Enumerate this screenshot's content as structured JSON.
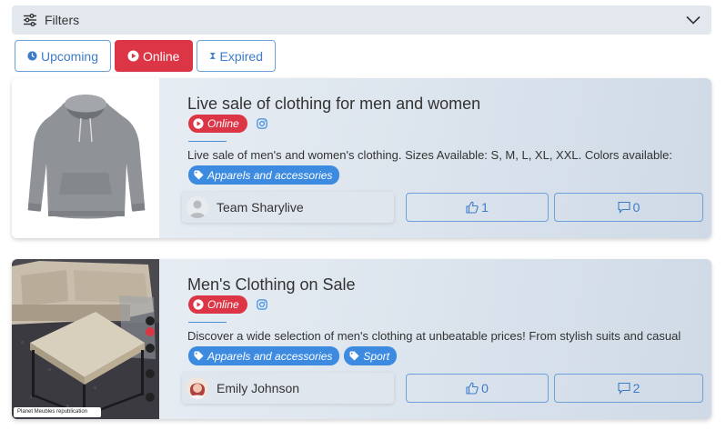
{
  "filters": {
    "label": "Filters"
  },
  "tabs": [
    {
      "label": "Upcoming",
      "icon": "clock-icon",
      "active": false
    },
    {
      "label": "Online",
      "icon": "play-icon",
      "active": true
    },
    {
      "label": "Expired",
      "icon": "hourglass-icon",
      "active": false
    }
  ],
  "colors": {
    "online": "#dc3545",
    "tag": "#3d8be0",
    "accent": "#3d7cc9"
  },
  "cards": [
    {
      "title": "Live sale of clothing for men and women",
      "status": "Online",
      "description": "Live sale of men's and women's clothing. Sizes Available: S, M, L, XL, XXL. Colors available:",
      "tags": [
        "Apparels and accessories"
      ],
      "author": "Team Sharylive",
      "likes": "1",
      "comments": "0"
    },
    {
      "title": "Men's Clothing on Sale",
      "status": "Online",
      "description": "Discover a wide selection of men's clothing at unbeatable prices! From stylish suits and casual",
      "tags": [
        "Apparels and accessories",
        "Sport"
      ],
      "author": "Emily Johnson",
      "likes": "0",
      "comments": "2",
      "thumb_caption": "Planet Meubles republication"
    }
  ]
}
